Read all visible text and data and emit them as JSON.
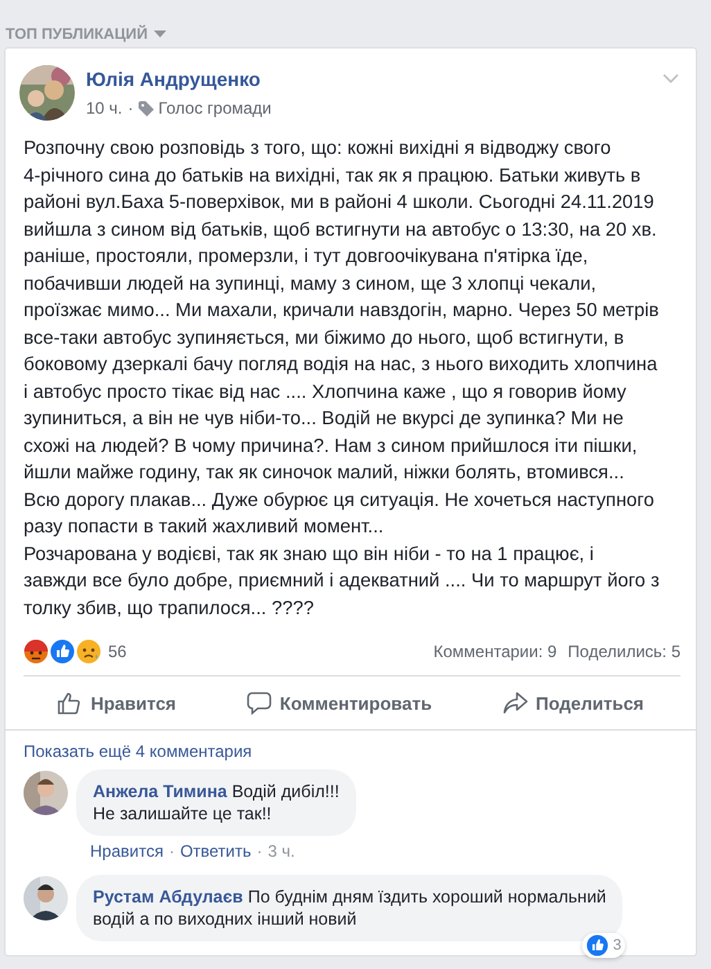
{
  "feed_header": {
    "label": "ТОП ПУБЛИКАЦИЙ"
  },
  "post": {
    "author": "Юлія Андрущенко",
    "meta": [
      {
        "kind": "text",
        "label": "10 ч."
      },
      {
        "kind": "dot",
        "label": "·"
      },
      {
        "kind": "group",
        "label": "Голос громади"
      }
    ],
    "text": "Розпочну свою розповідь з того, що: кожні вихідні я відводжу свого\n4-річного сина до батьків на вихідні, так як я працюю. Батьки живуть в\nрайоні вул.Баха 5-поверхівок, ми в районі 4 школи. Сьогодні 24.11.2019\nвийшла з сином від батьків, щоб встигнути на автобус о 13:30, на 20 хв.\nраніше, простояли, промерзли, і тут довгоочікувана п'ятірка їде,\nпобачивши людей на зупинці, маму з сином, ще 3 хлопці чекали,\nпроїзжає мимо... Ми махали, кричали навздогін, марно. Через 50 метрів\nвсе-таки автобус зупиняється, ми біжимо до нього, щоб встигнути, в\nбоковому дзеркалі бачу погляд водія на нас, з нього виходить хлопчина\nі автобус просто тікає від нас .... Хлопчина каже , що я говорив йому\nзупиниться, а він не чув ніби-то... Водій не вкурсі де зупинка? Ми не\nсхожі на людей? В чому причина?. Нам з сином прийшлося іти пішки,\nйшли майже годину, так як синочок малий, ніжки болять, втомився...\nВсю дорогу плакав... Дуже обурює ця ситуація. Не хочеться наступного\nразу попасти в такий жахливий момент...\nРозчарована у водієві, так як знаю що він ніби - то на 1 працює, і\nзавжди все було добре, приємний і адекватний .... Чи то маршрут його з\nтолку збив, що трапилося... ????",
    "reactions": [
      {
        "kind": "angry"
      },
      {
        "kind": "like"
      },
      {
        "kind": "sad"
      }
    ],
    "reaction_count": "56",
    "comments_count": "Комментарии: 9",
    "shares_count": "Поделились: 5",
    "actions": [
      {
        "kind": "like",
        "label": "Нравится"
      },
      {
        "kind": "comment",
        "label": "Комментировать"
      },
      {
        "kind": "share",
        "label": "Поделиться"
      }
    ]
  },
  "comments_section": {
    "more_link": "Показать ещё 4 комментария",
    "comments": [
      {
        "author": "Анжела Тимина",
        "text": "Водій дибіл!!!\nНе залишайте це так!!",
        "footer": [
          {
            "kind": "link",
            "label": "Нравится"
          },
          {
            "kind": "dot",
            "label": "·"
          },
          {
            "kind": "link",
            "label": "Ответить"
          },
          {
            "kind": "dot",
            "label": "·"
          },
          {
            "kind": "time",
            "label": "3 ч."
          }
        ]
      },
      {
        "author": "Рустам Абдулаєв",
        "text": "По буднім дням їздить хороший нормальний\nводій а по виходних інший новий",
        "reaction_count": "3"
      }
    ]
  }
}
